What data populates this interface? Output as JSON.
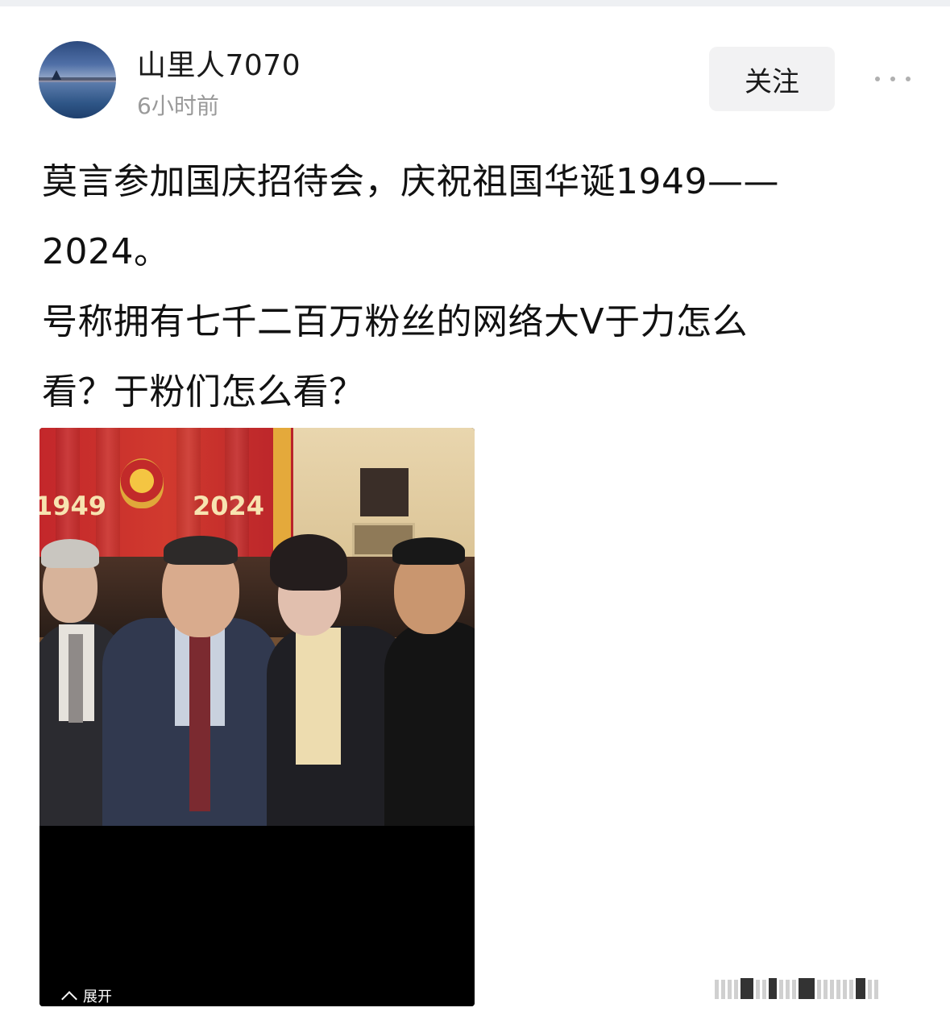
{
  "post": {
    "author": "山里人7070",
    "time": "6小时前",
    "follow_label": "关注",
    "more_icon": "more-dots-icon",
    "text_lines": [
      "莫言参加国庆招待会，庆祝祖国华诞1949——",
      "2024。",
      "号称拥有七千二百万粉丝的网络大V于力怎么",
      "看？于粉们怎么看？"
    ],
    "image": {
      "banner_left_year": "1949",
      "banner_right_year": "2024",
      "expand_label": "展开"
    }
  }
}
